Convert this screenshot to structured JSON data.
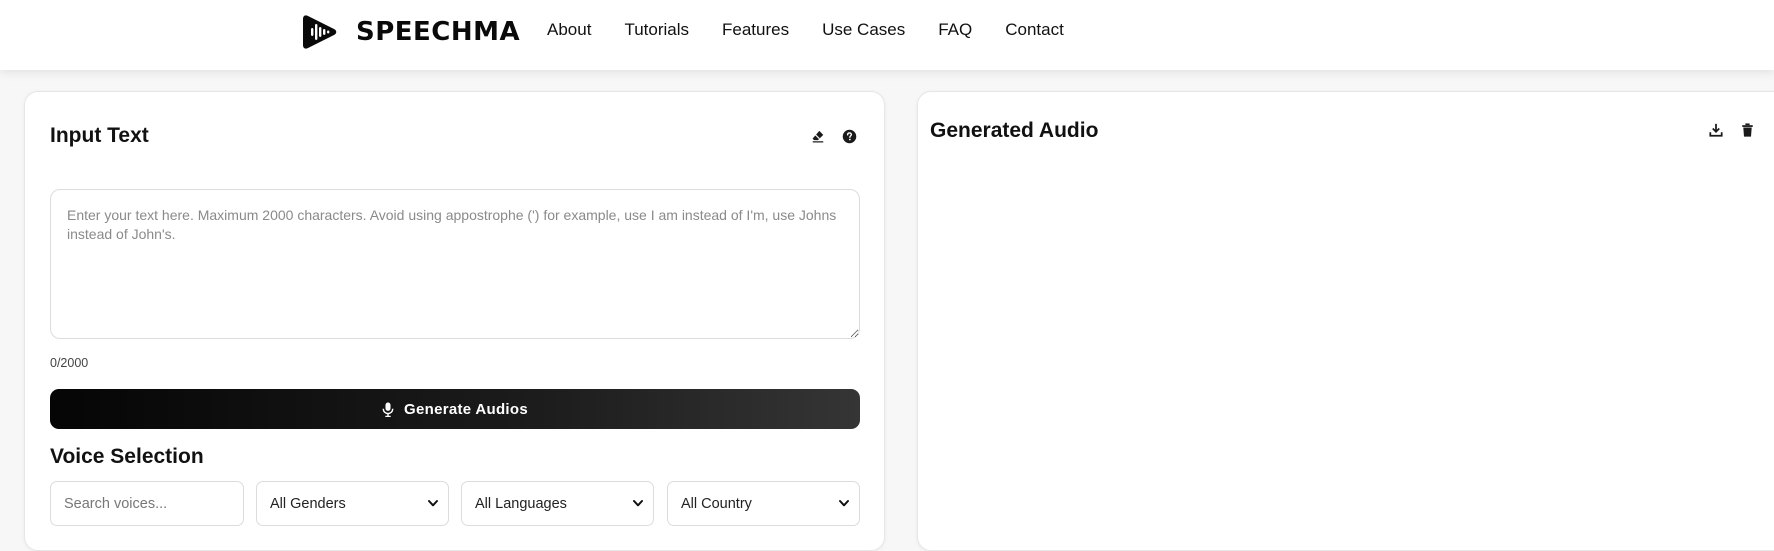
{
  "header": {
    "brand": "SPEECHMA",
    "nav": [
      "About",
      "Tutorials",
      "Features",
      "Use Cases",
      "FAQ",
      "Contact"
    ]
  },
  "input_card": {
    "title": "Input Text",
    "clear_icon": "eraser-icon",
    "help_icon": "question-circle-icon",
    "textarea_placeholder": "Enter your text here. Maximum 2000 characters. Avoid using appostrophe (') for example, use I am instead of I'm, use Johns instead of John's.",
    "textarea_value": "",
    "char_count": "0/2000",
    "generate_label": "Generate Audios",
    "generate_icon": "microphone-icon"
  },
  "voice_selection": {
    "title": "Voice Selection",
    "search_placeholder": "Search voices...",
    "gender_selected": "All Genders",
    "language_selected": "All Languages",
    "country_selected": "All Country"
  },
  "audio_card": {
    "title": "Generated Audio",
    "download_icon": "download-icon",
    "delete_icon": "trash-icon"
  },
  "colors": {
    "primary": "#0a0a0a",
    "background": "#f7f7f7",
    "card": "#ffffff",
    "border": "#dcdcdc"
  }
}
